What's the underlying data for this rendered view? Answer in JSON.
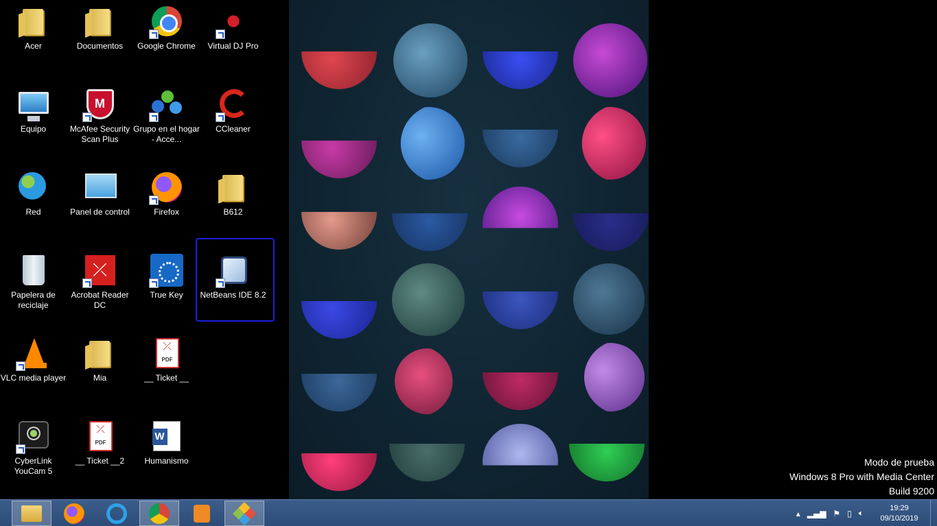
{
  "desktop": {
    "icons": [
      {
        "label": "Acer",
        "icon": "user-folder-icon"
      },
      {
        "label": "Documentos",
        "icon": "folder-icon"
      },
      {
        "label": "Google Chrome",
        "icon": "chrome-icon"
      },
      {
        "label": "Virtual DJ Pro",
        "icon": "virtual-dj-icon"
      },
      {
        "label": "Equipo",
        "icon": "computer-icon"
      },
      {
        "label": "McAfee Security Scan Plus",
        "icon": "mcafee-icon"
      },
      {
        "label": "Grupo en el hogar - Acce...",
        "icon": "homegroup-icon"
      },
      {
        "label": "CCleaner",
        "icon": "ccleaner-icon"
      },
      {
        "label": "Red",
        "icon": "network-icon"
      },
      {
        "label": "Panel de control",
        "icon": "control-panel-icon"
      },
      {
        "label": "Firefox",
        "icon": "firefox-icon"
      },
      {
        "label": "B612",
        "icon": "folder-icon"
      },
      {
        "label": "Papelera de reciclaje",
        "icon": "recycle-bin-icon"
      },
      {
        "label": "Acrobat Reader DC",
        "icon": "acrobat-icon"
      },
      {
        "label": "True Key",
        "icon": "truekey-icon"
      },
      {
        "label": "NetBeans IDE 8.2",
        "icon": "netbeans-icon"
      },
      {
        "label": "VLC media player",
        "icon": "vlc-icon"
      },
      {
        "label": "Mia",
        "icon": "folder-icon"
      },
      {
        "label": "__ Ticket __",
        "icon": "pdf-icon"
      },
      {
        "label": "CyberLink YouCam 5",
        "icon": "webcam-icon"
      },
      {
        "label": "__ Ticket __2",
        "icon": "pdf-icon"
      },
      {
        "label": "Humanismo",
        "icon": "word-doc-icon"
      }
    ],
    "pdf_badge": "PDF"
  },
  "watermark": {
    "line1": "Modo de prueba",
    "line2": "Windows 8 Pro with Media Center",
    "line3": "Build 9200"
  },
  "taskbar": {
    "buttons": [
      "file-explorer-icon",
      "firefox-icon",
      "internet-explorer-icon",
      "chrome-icon",
      "media-player-icon",
      "git-icon"
    ],
    "tray": {
      "time": "19:29",
      "date": "09/10/2019"
    }
  },
  "colors": {
    "taskbar": "#2d4c78",
    "selection_frame": "#1b1fd8"
  }
}
